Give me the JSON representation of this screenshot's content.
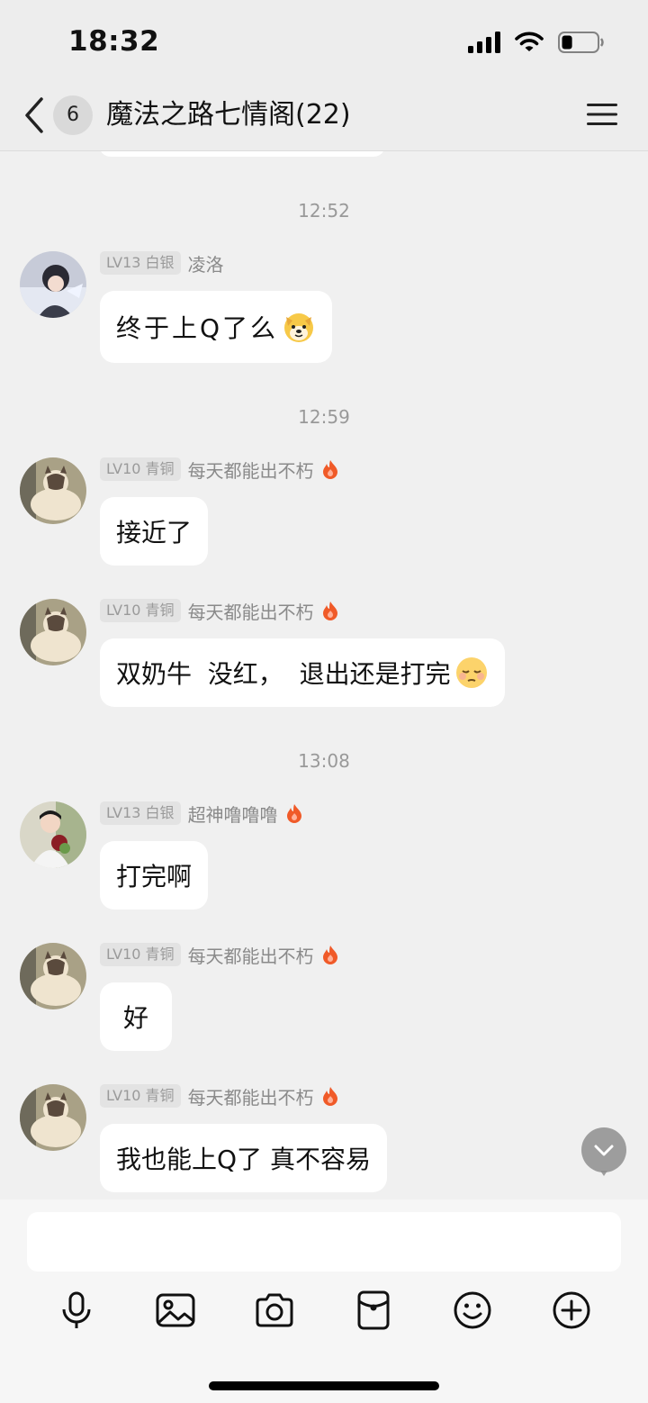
{
  "status_bar": {
    "time": "18:32",
    "battery_level": 0.3
  },
  "nav": {
    "unread_count": "6",
    "title": "魔法之路七情阁(22)"
  },
  "timestamps": [
    "12:52",
    "12:59",
    "13:08"
  ],
  "messages": [
    {
      "level": "LV13 白银",
      "sender": "凌洛",
      "text": "终于上Q了么",
      "emoji": "dog-face-emoji",
      "flame": false
    },
    {
      "level": "LV10 青铜",
      "sender": "每天都能出不朽",
      "text": "接近了",
      "flame": true
    },
    {
      "level": "LV10 青铜",
      "sender": "每天都能出不朽",
      "text": "双奶牛  没红，  退出还是打完",
      "emoji": "pensive-face-emoji",
      "flame": true
    },
    {
      "level": "LV13 白银",
      "sender": "超神噜噜噜",
      "text": "打完啊",
      "flame": true
    },
    {
      "level": "LV10 青铜",
      "sender": "每天都能出不朽",
      "text": "好",
      "flame": true
    },
    {
      "level": "LV10 青铜",
      "sender": "每天都能出不朽",
      "text": "我也能上Q了 真不容易",
      "flame": true
    }
  ],
  "input": {
    "value": "",
    "placeholder": ""
  },
  "colors": {
    "background": "#f0f0f0",
    "bubble": "#ffffff",
    "flame": "#f05a28",
    "badge_text": "#9a9a9a"
  }
}
